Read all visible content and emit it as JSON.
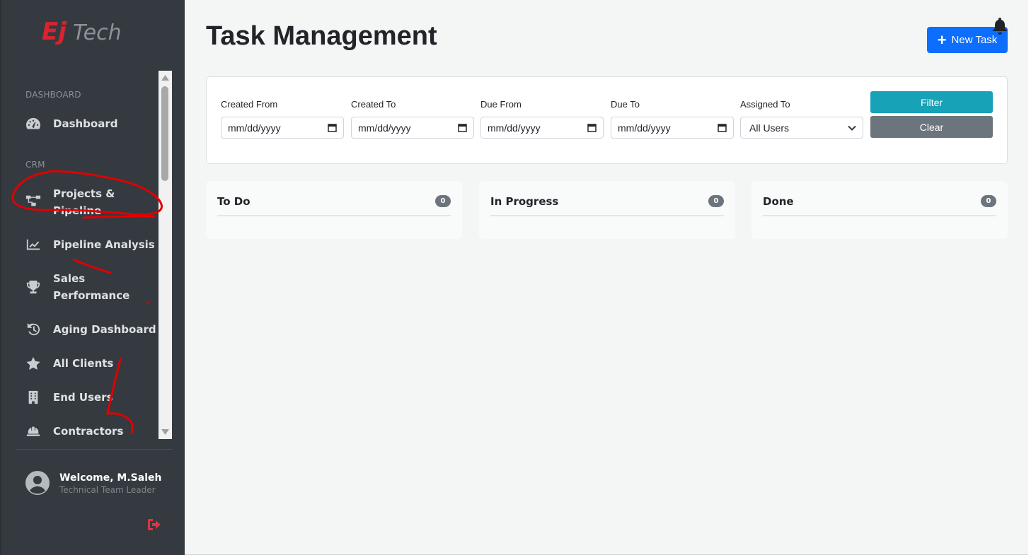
{
  "brand": {
    "logo_text": "EjTech",
    "accent_color": "#d9232e"
  },
  "sidebar": {
    "sections": [
      {
        "label": "DASHBOARD"
      },
      {
        "label": "CRM"
      }
    ],
    "items": [
      {
        "label": "Dashboard",
        "icon": "tachometer-icon"
      },
      {
        "label": "Projects &",
        "label2": "Pipeline",
        "icon": "project-diagram-icon"
      },
      {
        "label": "Pipeline Analysis",
        "icon": "chart-line-icon"
      },
      {
        "label": "Sales",
        "label2": "Performance",
        "icon": "trophy-icon"
      },
      {
        "label": "Aging Dashboard",
        "icon": "history-icon"
      },
      {
        "label": "All Clients",
        "icon": "star-icon"
      },
      {
        "label": "End Users",
        "icon": "building-icon"
      },
      {
        "label": "Contractors",
        "icon": "hard-hat-icon"
      }
    ],
    "user": {
      "welcome": "Welcome, M.Saleh",
      "role": "Technical Team Leader"
    }
  },
  "main": {
    "title": "Task Management",
    "new_task_label": "New Task",
    "filters": {
      "created_from": {
        "label": "Created From",
        "value": "mm/dd/yyyy"
      },
      "created_to": {
        "label": "Created To",
        "value": "mm/dd/yyyy"
      },
      "due_from": {
        "label": "Due From",
        "value": "mm/dd/yyyy"
      },
      "due_to": {
        "label": "Due To",
        "value": "mm/dd/yyyy"
      },
      "assigned_to": {
        "label": "Assigned To",
        "value": "All Users"
      },
      "filter_label": "Filter",
      "clear_label": "Clear"
    },
    "columns": [
      {
        "title": "To Do",
        "count": "0"
      },
      {
        "title": "In Progress",
        "count": "0"
      },
      {
        "title": "Done",
        "count": "0"
      }
    ]
  },
  "colors": {
    "sidebar_bg": "#343a40",
    "primary": "#0d6efd",
    "info": "#17a2b8",
    "secondary": "#6c757d",
    "annotation": "#e00000"
  }
}
